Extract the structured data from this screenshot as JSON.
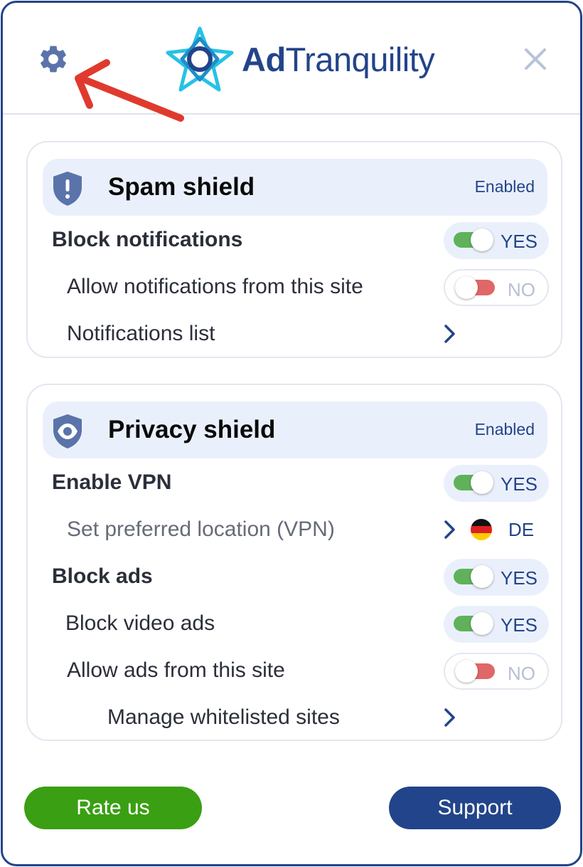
{
  "brand": {
    "name_bold": "Ad",
    "name_rest": "Tranquility"
  },
  "colors": {
    "brand_blue": "#22448a",
    "toggle_on": "#5fb25b",
    "toggle_off": "#e06767",
    "rate_button": "#3a9f13",
    "panel_bg": "#eaf0fb",
    "annotation_arrow": "#e03a2e"
  },
  "header": {
    "settings_icon": "gear-icon",
    "close_icon": "close-icon"
  },
  "spam_shield": {
    "title": "Spam shield",
    "status": "Enabled",
    "icon": "shield-exclamation-icon",
    "rows": {
      "block_notifications": {
        "label": "Block notifications",
        "toggle": "YES"
      },
      "allow_notifications": {
        "label": "Allow notifications from this site",
        "toggle": "NO"
      },
      "notifications_list": {
        "label": "Notifications list"
      }
    }
  },
  "privacy_shield": {
    "title": "Privacy shield",
    "status": "Enabled",
    "icon": "shield-eye-icon",
    "rows": {
      "enable_vpn": {
        "label": "Enable VPN",
        "toggle": "YES"
      },
      "preferred_location": {
        "label": "Set preferred location (VPN)",
        "country_code": "DE"
      },
      "block_ads": {
        "label": "Block ads",
        "toggle": "YES"
      },
      "block_video_ads": {
        "label": "Block video ads",
        "toggle": "YES"
      },
      "allow_ads": {
        "label": "Allow ads from this site",
        "toggle": "NO"
      },
      "manage_whitelist": {
        "label": "Manage whitelisted sites"
      }
    }
  },
  "footer": {
    "rate_label": "Rate us",
    "support_label": "Support"
  }
}
